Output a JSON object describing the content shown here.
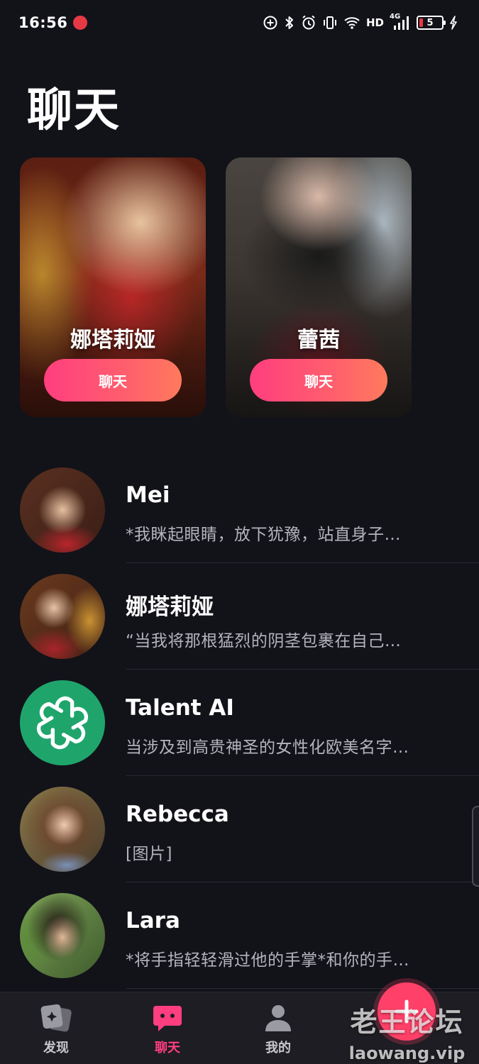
{
  "status_bar": {
    "time": "16:56",
    "network": "HD",
    "network_gen": "4G",
    "battery_level": "5"
  },
  "page": {
    "title": "聊天"
  },
  "featured": [
    {
      "name": "娜塔莉娅",
      "button_label": "聊天"
    },
    {
      "name": "蕾茜",
      "button_label": "聊天"
    }
  ],
  "chats": [
    {
      "name": "Mei",
      "preview": "*我眯起眼睛，放下犹豫，站直身子…"
    },
    {
      "name": "娜塔莉娅",
      "preview": "“当我将那根猛烈的阴茎包裹在自己…"
    },
    {
      "name": "Talent AI",
      "preview": "当涉及到高贵神圣的女性化欧美名字…"
    },
    {
      "name": "Rebecca",
      "preview": "[图片]"
    },
    {
      "name": "Lara",
      "preview": "*将手指轻轻滑过他的手掌*和你的手…"
    }
  ],
  "nav": {
    "discover": "发现",
    "chat": "聊天",
    "mine": "我的"
  },
  "watermark": {
    "cn": "老王论坛",
    "en": "laowang.vip"
  },
  "colors": {
    "background": "#121219",
    "accent": "#ff3e7f",
    "talent_ai_green": "#1fa56c"
  }
}
